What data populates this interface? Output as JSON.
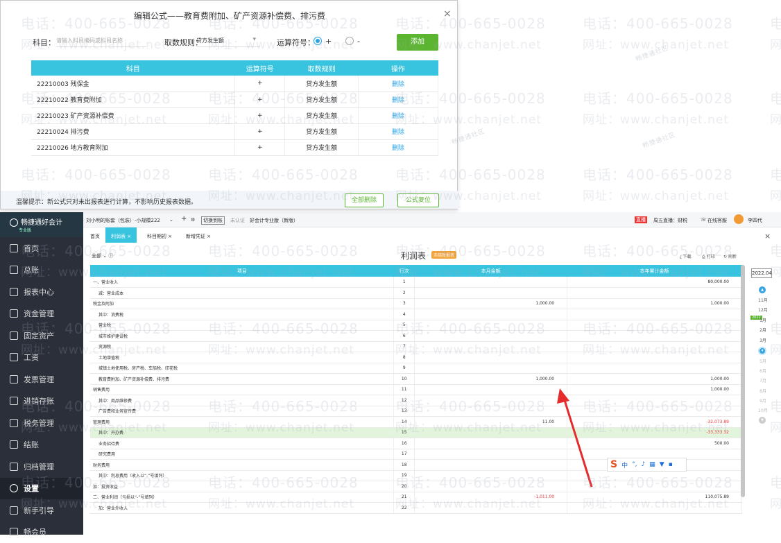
{
  "dialog": {
    "title": "编辑公式——教育费附加、矿产资源补偿费、排污费",
    "subject_label": "科目：",
    "subject_placeholder": "请输入科目编码或科目名称",
    "rule_label": "取数规则：",
    "rule_value": "贷方发生额",
    "operator_label": "运算符号：",
    "op_plus": "+",
    "op_minus": "-",
    "add_button": "添加",
    "columns": [
      "科目",
      "运算符号",
      "取数规则",
      "操作"
    ],
    "rows": [
      {
        "subject": "22210003 残保金",
        "op": "+",
        "rule": "贷方发生额",
        "action": "删除"
      },
      {
        "subject": "22210022 教育费附加",
        "op": "+",
        "rule": "贷方发生额",
        "action": "删除"
      },
      {
        "subject": "22210023 矿产资源补偿费",
        "op": "+",
        "rule": "贷方发生额",
        "action": "删除"
      },
      {
        "subject": "22210024 排污费",
        "op": "+",
        "rule": "贷方发生额",
        "action": "删除"
      },
      {
        "subject": "22210026 地方教育附加",
        "op": "+",
        "rule": "贷方发生额",
        "action": "删除"
      }
    ],
    "tip": "温馨提示：新公式只对未出报表进行计算，不影响历史报表数据。",
    "delete_all": "全部删除",
    "reset": "公式复位",
    "close": "×"
  },
  "sidebar": {
    "brand": "畅捷通好会计",
    "edition": "专业版",
    "items": [
      "首页",
      "总账",
      "报表中心",
      "资金管理",
      "固定资产",
      "工资",
      "发票管理",
      "进销存账",
      "税务管理",
      "结账",
      "归档管理",
      "设置",
      "新手引导",
      "畅会员"
    ],
    "active": "设置"
  },
  "topbar": {
    "company": "刘小明的账套（包装）-小规模222",
    "plus": "+",
    "switch": "切换到账",
    "cert": "未认证",
    "cert_desc": "好会计专业版（新版）",
    "live": "直播",
    "live_text": "周五直播：财税",
    "service": "在线客服",
    "user": "李四代"
  },
  "tabs": [
    "首页",
    "利润表 ×",
    "科目期初 ×",
    "新增凭证 ×"
  ],
  "report": {
    "title": "利润表",
    "badge": "未结账报表",
    "filter": "全部",
    "download": "下载",
    "print": "打印",
    "refresh": "刷新",
    "columns": [
      "项目",
      "行次",
      "本月金额",
      "本年累计金额"
    ],
    "rows": [
      {
        "name": "一、营业收入",
        "no": "1",
        "month": "",
        "year": "80,000.00"
      },
      {
        "name": "减：营业成本",
        "no": "2",
        "month": "",
        "year": ""
      },
      {
        "name": "税金及附加",
        "no": "3",
        "month": "1,000.00",
        "year": "1,000.00"
      },
      {
        "name": "其中：消费税",
        "no": "4",
        "month": "",
        "year": ""
      },
      {
        "name": "营业税",
        "no": "5",
        "month": "",
        "year": ""
      },
      {
        "name": "城市维护建设税",
        "no": "6",
        "month": "",
        "year": ""
      },
      {
        "name": "资源税",
        "no": "7",
        "month": "",
        "year": ""
      },
      {
        "name": "土地增值税",
        "no": "8",
        "month": "",
        "year": ""
      },
      {
        "name": "城镇土地使用税、房产税、车船税、印花税",
        "no": "9",
        "month": "",
        "year": ""
      },
      {
        "name": "教育费附加、矿产资源补偿费、排污费",
        "no": "10",
        "month": "1,000.00",
        "year": "1,000.00"
      },
      {
        "name": "销售费用",
        "no": "11",
        "month": "",
        "year": "1,000.00"
      },
      {
        "name": "其中：商品维修费",
        "no": "12",
        "month": "",
        "year": ""
      },
      {
        "name": "广告费和业务宣传费",
        "no": "13",
        "month": "",
        "year": ""
      },
      {
        "name": "管理费用",
        "no": "14",
        "month": "11.00",
        "year": "-32,073.89"
      },
      {
        "name": "其中：开办费",
        "no": "15",
        "month": "",
        "year": "-33,333.32"
      },
      {
        "name": "业务招待费",
        "no": "16",
        "month": "",
        "year": "500.00"
      },
      {
        "name": "研究费用",
        "no": "17",
        "month": "",
        "year": ""
      },
      {
        "name": "财务费用",
        "no": "18",
        "month": "",
        "year": ""
      },
      {
        "name": "其中：利息费用（收入以“-”号填列）",
        "no": "19",
        "month": "",
        "year": ""
      },
      {
        "name": "加：投资收益",
        "no": "20",
        "month": "",
        "year": ""
      },
      {
        "name": "二、营业利润（亏损以“-”号填列）",
        "no": "21",
        "month": "-1,011.00",
        "year": "110,075.89"
      },
      {
        "name": "加：营业外收入",
        "no": "22",
        "month": "",
        "year": ""
      }
    ]
  },
  "periods": {
    "year": "2022.04",
    "months_top": [
      "11月",
      "12月"
    ],
    "tag": "2022",
    "months": [
      "1月",
      "2月",
      "3月",
      "4月",
      "5月",
      "6月",
      "7月",
      "8月",
      "9月",
      "10月"
    ]
  },
  "watermark": {
    "phone": "电话：400-665-0028",
    "site": "网址：www.chanjet.net",
    "small": "畅捷通社区"
  },
  "ime": {
    "brand": "S",
    "lang": "中"
  }
}
